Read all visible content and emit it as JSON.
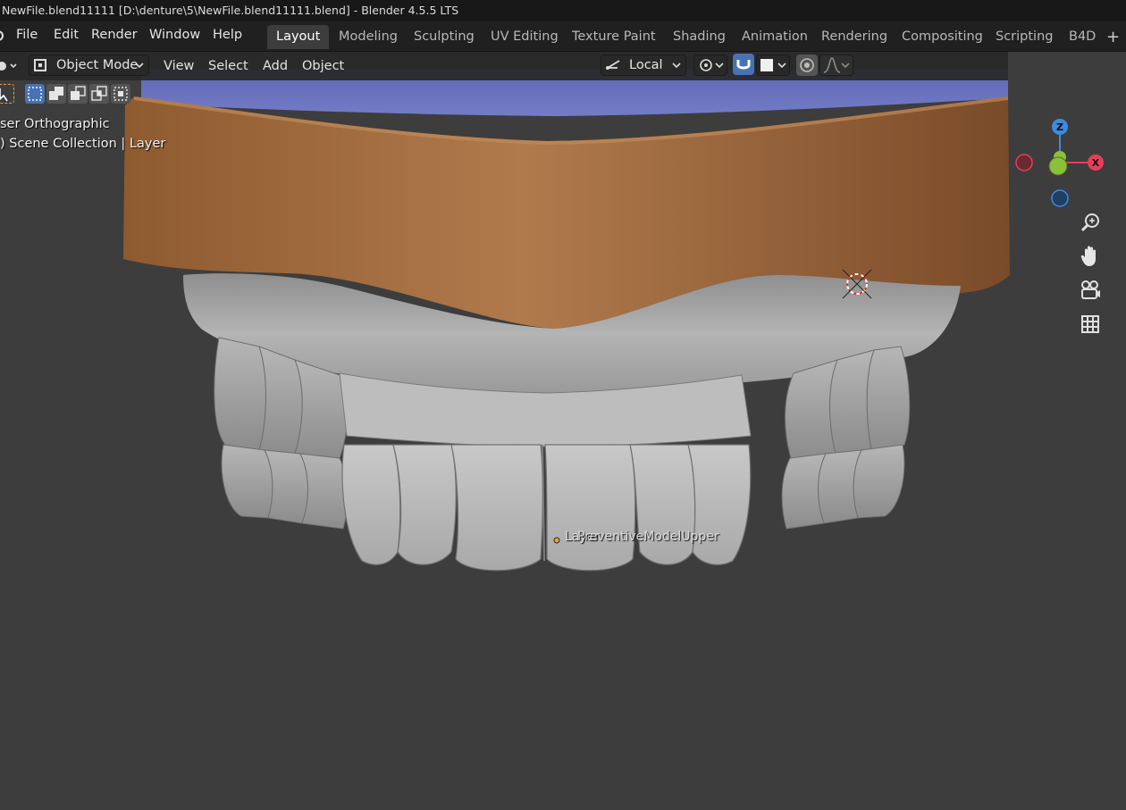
{
  "window": {
    "title": "NewFile.blend11111 [D:\\denture\\5\\NewFile.blend11111.blend] - Blender 4.5.5 LTS"
  },
  "menu": {
    "items": [
      "File",
      "Edit",
      "Render",
      "Window",
      "Help"
    ]
  },
  "workspaces": {
    "tabs": [
      "Layout",
      "Modeling",
      "Sculpting",
      "UV Editing",
      "Texture Paint",
      "Shading",
      "Animation",
      "Rendering",
      "Compositing",
      "Scripting",
      "B4D"
    ],
    "active": "Layout",
    "add_label": "+"
  },
  "viewport_header": {
    "mode": "Object Mode",
    "menus": [
      "View",
      "Select",
      "Add",
      "Object"
    ],
    "transform_orientation": "Local"
  },
  "viewport": {
    "view_name": "ser Orthographic",
    "collection_info": ") Scene Collection | Layer",
    "object_labels": [
      "Layer",
      "PreventiveModelUpper"
    ]
  },
  "gizmo": {
    "z": "Z",
    "x": "X",
    "colors": {
      "x": "#e83e55",
      "y": "#8bc03a",
      "z": "#3d8ae0"
    }
  },
  "icons": {
    "editor_type": "editor-type-icon",
    "mode": "object-mode-icon",
    "orientation": "transform-orientation-icon",
    "pivot": "pivot-point-icon",
    "snap": "snap-magnet-icon",
    "proportional": "proportional-edit-icon",
    "zoom": "zoom-icon",
    "pan": "hand-icon",
    "camera": "camera-icon",
    "grid": "grid-icon"
  }
}
